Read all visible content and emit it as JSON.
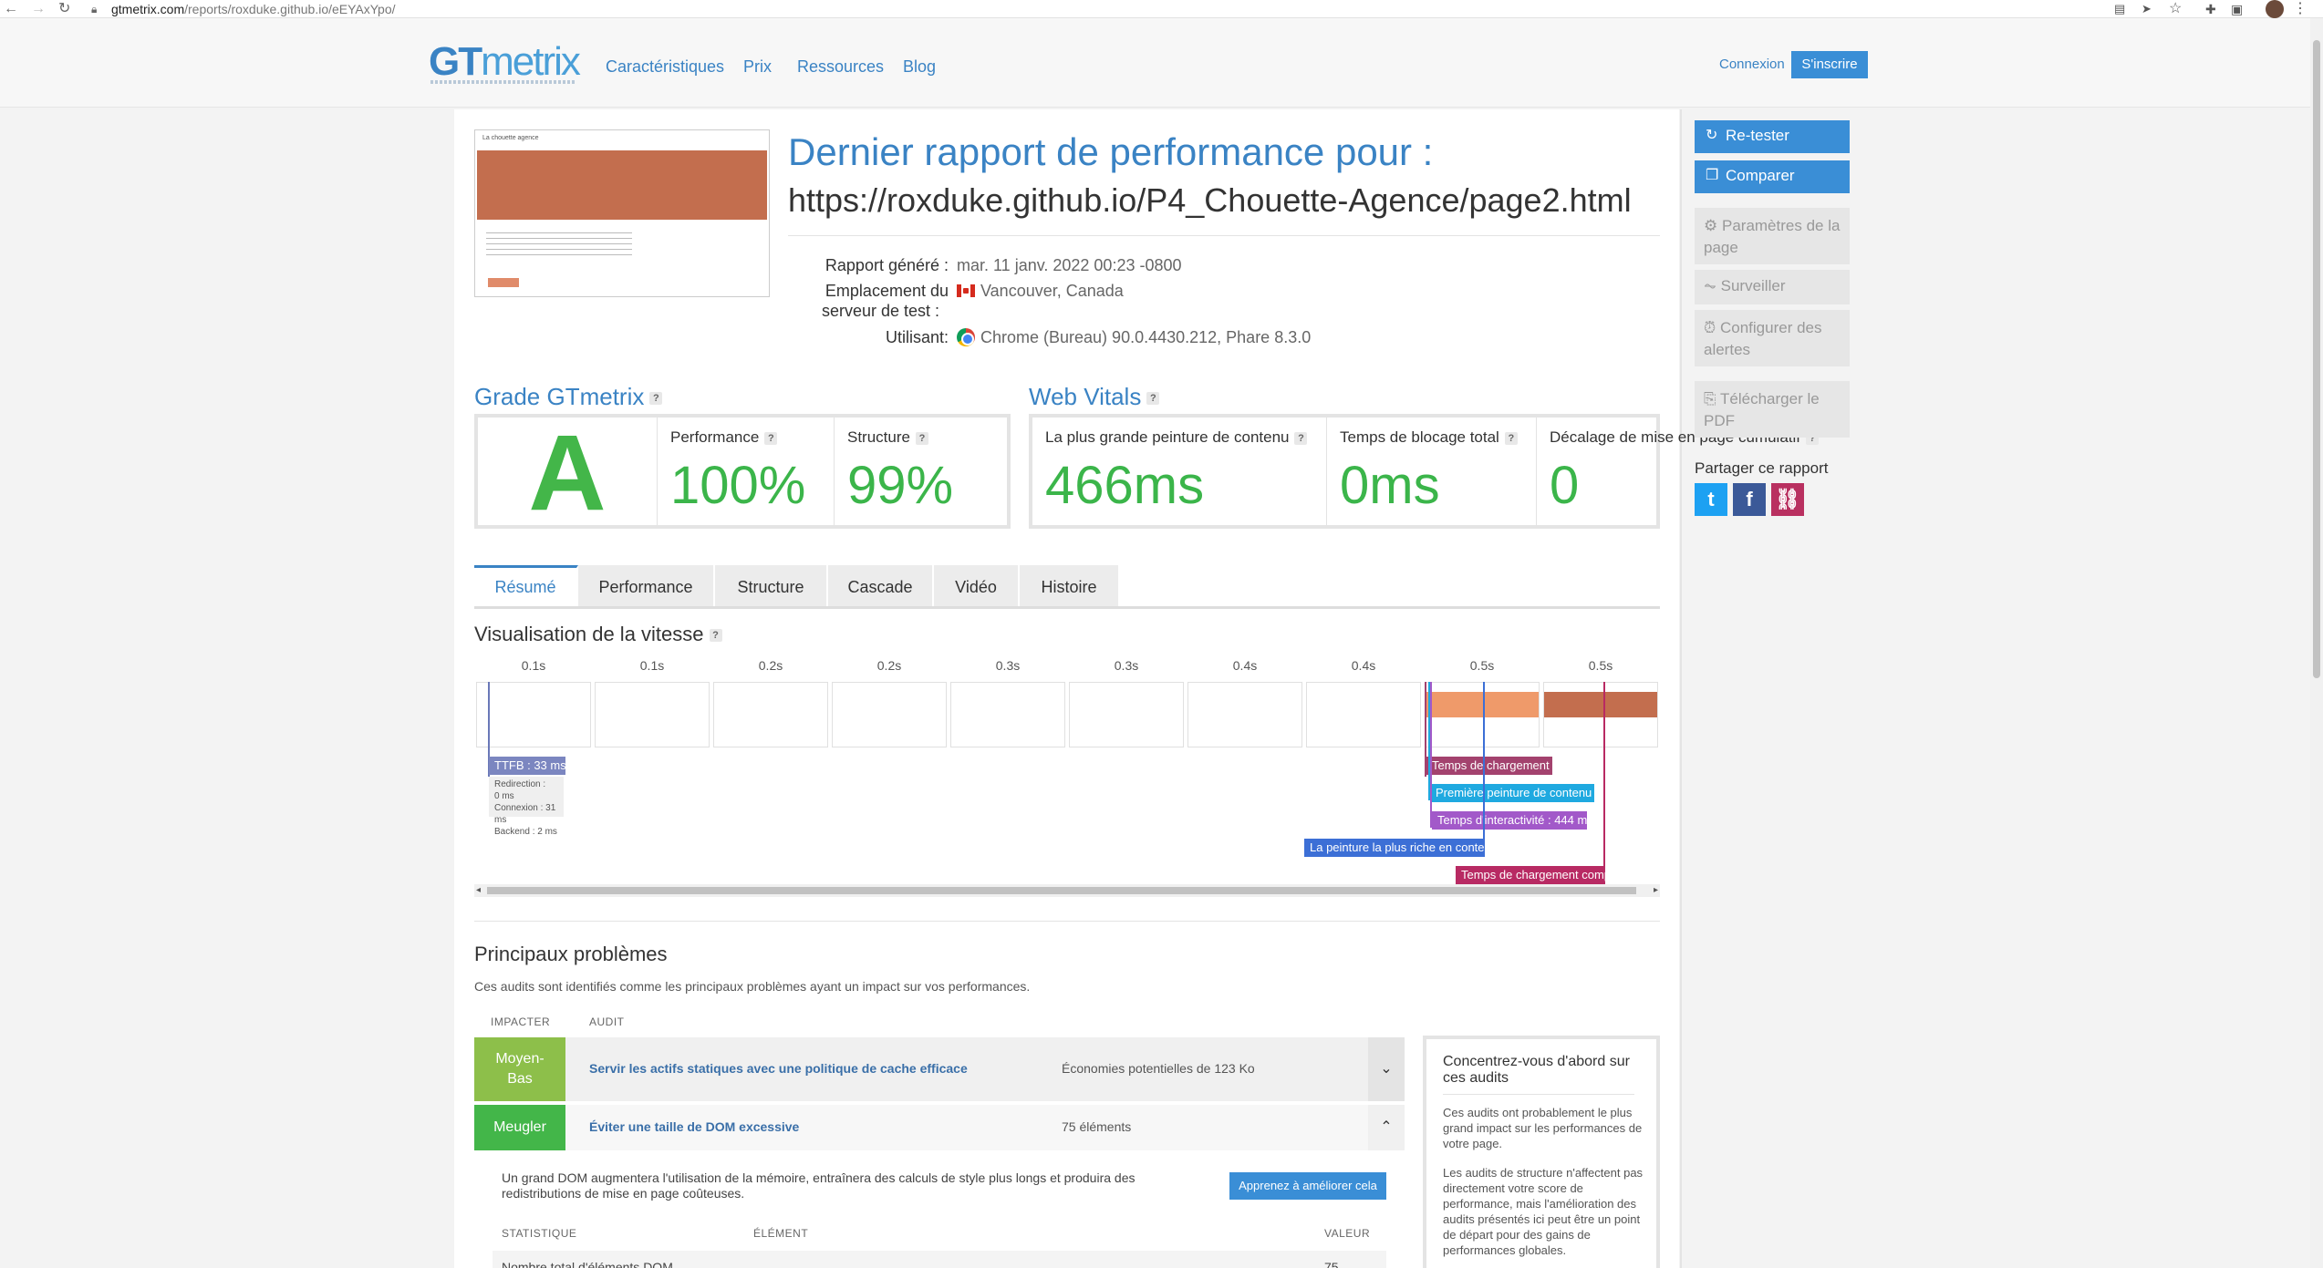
{
  "browser": {
    "url_host": "gtmetrix.com",
    "url_path": "/reports/roxduke.github.io/eEYAxYpo/"
  },
  "header": {
    "logo_gt": "GT",
    "logo_metrix": "metrix",
    "nav": [
      "Caractéristiques",
      "Prix",
      "Ressources",
      "Blog"
    ],
    "login": "Connexion",
    "signup": "S'inscrire"
  },
  "report": {
    "title": "Dernier rapport de performance pour :",
    "url": "https://roxduke.github.io/P4_Chouette-Agence/page2.html",
    "generated_label": "Rapport généré :",
    "generated_value": "mar. 11 janv. 2022 00:23 -0800",
    "location_label_1": "Emplacement du",
    "location_label_2": "serveur de test :",
    "location_value": "Vancouver, Canada",
    "using_label": "Utilisant:",
    "using_value": "Chrome (Bureau) 90.0.4430.212, Phare 8.3.0",
    "thumb_header": "La chouette agence"
  },
  "grade": {
    "heading": "Grade GTmetrix",
    "letter": "A",
    "performance_label": "Performance",
    "performance_value": "100%",
    "structure_label": "Structure",
    "structure_value": "99%"
  },
  "vitals": {
    "heading": "Web Vitals",
    "lcp_label": "La plus grande peinture de contenu",
    "lcp_value": "466ms",
    "tbt_label": "Temps de blocage total",
    "tbt_value": "0ms",
    "cls_label": "Décalage de mise en page cumulatif",
    "cls_value": "0"
  },
  "tabs": [
    "Résumé",
    "Performance",
    "Structure",
    "Cascade",
    "Vidéo",
    "Histoire"
  ],
  "speed": {
    "title": "Visualisation de la vitesse",
    "ticks": [
      "0.1s",
      "0.1s",
      "0.2s",
      "0.2s",
      "0.3s",
      "0.3s",
      "0.4s",
      "0.4s",
      "0.5s",
      "0.5s"
    ],
    "ttfb": "TTFB : 33 ms",
    "ttfb_detail": [
      "Redirection :",
      "0 ms Connexion : 31 ms",
      "Backend : 2 ms"
    ],
    "markers": {
      "load": "Temps de chargement",
      "fcp": "Première peinture de contenu",
      "tti": "Temps d'interactivité : 444 ms",
      "lcp": "La peinture la plus riche en contenu",
      "onload": "Temps de chargement complet"
    }
  },
  "issues": {
    "title": "Principaux problèmes",
    "description": "Ces audits sont identifiés comme les principaux problèmes ayant un impact sur vos performances.",
    "col_impact": "IMPACTER",
    "col_audit": "AUDIT",
    "rows": [
      {
        "impact_1": "Moyen-",
        "impact_2": "Bas",
        "title": "Servir les actifs statiques avec une politique de cache efficace",
        "metric": "Économies potentielles de 123 Ko",
        "color": "#8dbf4a"
      },
      {
        "impact": "Meugler",
        "title": "Éviter une taille de DOM excessive",
        "metric": "75 éléments",
        "color": "#43b649"
      }
    ],
    "dom_description": "Un grand DOM augmentera l'utilisation de la mémoire, entraînera des calculs de style plus longs et produira des redistributions de mise en page coûteuses.",
    "learn_button": "Apprenez à améliorer cela",
    "stat_col": "STATISTIQUE",
    "element_col": "ÉLÉMENT",
    "value_col": "VALEUR",
    "stat_label": "Nombre total d'éléments DOM",
    "stat_value": "75"
  },
  "focus": {
    "title": "Concentrez-vous d'abord sur ces audits",
    "p1": "Ces audits ont probablement le plus grand impact sur les performances de votre page.",
    "p2": "Les audits de structure n'affectent pas directement votre score de performance, mais l'amélioration des audits présentés ici peut être un point de départ pour des gains de performances globales."
  },
  "sidebar": {
    "retest": "Re-tester",
    "compare": "Comparer",
    "page_settings": "Paramètres de la page",
    "monitor": "Surveiller",
    "alerts": "Configurer des alertes",
    "pdf": "Télécharger le PDF",
    "share_label": "Partager ce rapport"
  },
  "colors": {
    "accent": "#3a83c4",
    "grade_green": "#43b649",
    "marker_load": "#a3426e",
    "marker_fcp": "#1fa9e0",
    "marker_tti": "#a259c9",
    "marker_lcp": "#3c6fd6",
    "marker_onload": "#b82a63"
  }
}
